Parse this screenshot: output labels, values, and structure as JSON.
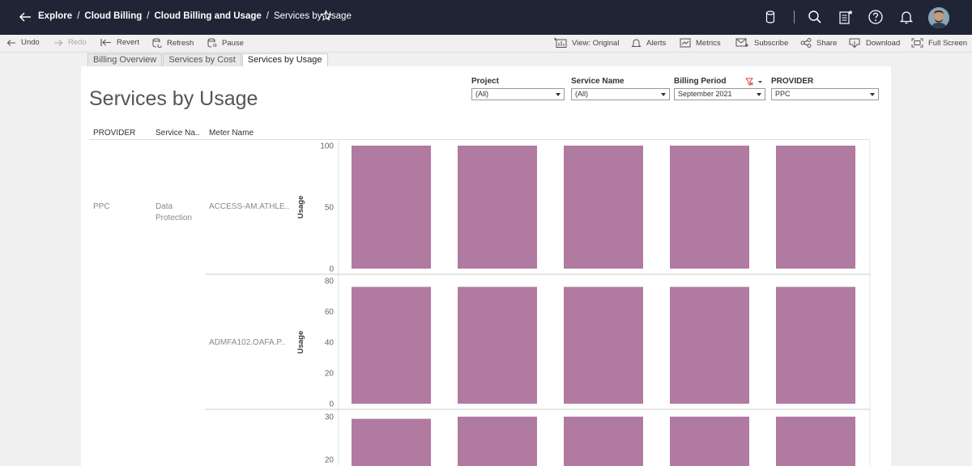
{
  "nav": {
    "breadcrumbs": [
      "Explore",
      "Cloud Billing",
      "Cloud Billing and Usage",
      "Services by Usage"
    ]
  },
  "toolbar": {
    "undo": "Undo",
    "redo": "Redo",
    "revert": "Revert",
    "refresh": "Refresh",
    "pause": "Pause",
    "view": "View: Original",
    "alerts": "Alerts",
    "metrics": "Metrics",
    "subscribe": "Subscribe",
    "share": "Share",
    "download": "Download",
    "fullscreen": "Full Screen"
  },
  "tabs": [
    "Billing Overview",
    "Services by Cost",
    "Services by Usage"
  ],
  "page_title": "Services by Usage",
  "filters": {
    "project": {
      "label": "Project",
      "value": "(All)"
    },
    "service": {
      "label": "Service Name",
      "value": "(All)"
    },
    "billing": {
      "label": "Billing Period",
      "value": "September 2021"
    },
    "provider": {
      "label": "PROVIDER",
      "value": "PPC"
    }
  },
  "columns": {
    "provider": "PROVIDER",
    "service": "Service Na..",
    "meter": "Meter Name"
  },
  "rows": {
    "provider": "PPC",
    "service_line1": "Data",
    "service_line2": "Protection",
    "meter1": "ACCESS-AM.ATHLE..",
    "meter2": "ADMFA102.OAFA.P.."
  },
  "colors": {
    "bar": "#b07aa1",
    "topbar": "#1f2535"
  },
  "chart_data": [
    {
      "type": "bar",
      "ylabel": "Usage",
      "ylim": [
        0,
        100
      ],
      "ticks": [
        0,
        50,
        100
      ],
      "values": [
        100,
        100,
        100,
        100,
        100
      ]
    },
    {
      "type": "bar",
      "ylabel": "Usage",
      "ylim": [
        0,
        80
      ],
      "ticks": [
        0,
        20,
        40,
        60,
        80
      ],
      "values": [
        76,
        76,
        76,
        76,
        76
      ]
    },
    {
      "type": "bar",
      "ylabel": "",
      "ylim": [
        20,
        30
      ],
      "ticks": [
        20,
        30
      ],
      "values": [
        29.5,
        30,
        30,
        30,
        30
      ]
    }
  ]
}
